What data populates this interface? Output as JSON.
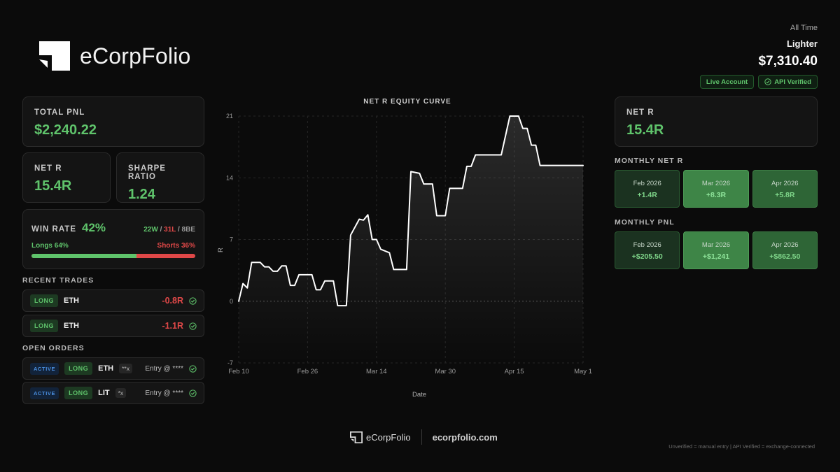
{
  "brand": {
    "name": "eCorpFolio"
  },
  "account": {
    "period": "All Time",
    "name": "Lighter",
    "balance": "$7,310.40",
    "badges": [
      "Live Account",
      "API Verified"
    ]
  },
  "stats": {
    "total_pnl_label": "TOTAL PNL",
    "total_pnl": "$2,240.22",
    "net_r_label": "NET R",
    "net_r": "15.4R",
    "sharpe_label": "SHARPE RATIO",
    "sharpe": "1.24",
    "win_rate_label": "WIN RATE",
    "win_rate": "42%",
    "wins": "22W",
    "losses": "31L",
    "breakeven": "8BE",
    "sep": "/",
    "longs_label": "Longs 64%",
    "shorts_label": "Shorts 36%",
    "longs_fraction": 0.64
  },
  "recent_trades": {
    "title": "RECENT TRADES",
    "items": [
      {
        "side": "LONG",
        "symbol": "ETH",
        "r": "-0.8R"
      },
      {
        "side": "LONG",
        "symbol": "ETH",
        "r": "-1.1R"
      }
    ]
  },
  "open_orders": {
    "title": "OPEN ORDERS",
    "items": [
      {
        "status": "ACTIVE",
        "side": "LONG",
        "symbol": "ETH",
        "qty": "**x",
        "entry": "Entry @ ****"
      },
      {
        "status": "ACTIVE",
        "side": "LONG",
        "symbol": "LIT",
        "qty": "*x",
        "entry": "Entry @ ****"
      }
    ]
  },
  "right": {
    "net_r_label": "NET R",
    "net_r": "15.4R",
    "monthly_r_title": "MONTHLY NET R",
    "monthly_r": [
      {
        "month": "Feb 2026",
        "value": "+1.4R"
      },
      {
        "month": "Mar 2026",
        "value": "+8.3R"
      },
      {
        "month": "Apr 2026",
        "value": "+5.8R"
      }
    ],
    "monthly_pnl_title": "MONTHLY PNL",
    "monthly_pnl": [
      {
        "month": "Feb 2026",
        "value": "+$205.50"
      },
      {
        "month": "Mar 2026",
        "value": "+$1,241"
      },
      {
        "month": "Apr 2026",
        "value": "+$862.50"
      }
    ]
  },
  "chart_data": {
    "type": "line",
    "title": "NET R EQUITY CURVE",
    "xlabel": "Date",
    "ylabel": "R",
    "x_ticks": [
      "Feb 10",
      "Feb 26",
      "Mar 14",
      "Mar 30",
      "Apr 15",
      "May 1"
    ],
    "x_range": [
      "2026-02-10",
      "2026-05-01"
    ],
    "y_ticks": [
      -7,
      0,
      7,
      14,
      21
    ],
    "ylim": [
      -7,
      21
    ],
    "grid": true,
    "colors": {
      "line": "#ffffff",
      "zero_line": "#555555",
      "grid": "#262626"
    },
    "series": [
      {
        "points": [
          [
            "2026-02-10",
            0.0
          ],
          [
            "2026-02-11",
            2.0
          ],
          [
            "2026-02-12",
            1.5
          ],
          [
            "2026-02-13",
            4.4
          ],
          [
            "2026-02-15",
            4.4
          ],
          [
            "2026-02-16",
            3.9
          ],
          [
            "2026-02-17",
            3.9
          ],
          [
            "2026-02-18",
            3.4
          ],
          [
            "2026-02-19",
            3.4
          ],
          [
            "2026-02-20",
            4.0
          ],
          [
            "2026-02-21",
            4.0
          ],
          [
            "2026-02-22",
            1.8
          ],
          [
            "2026-02-23",
            1.8
          ],
          [
            "2026-02-24",
            3.0
          ],
          [
            "2026-02-27",
            3.0
          ],
          [
            "2026-02-28",
            1.3
          ],
          [
            "2026-03-01",
            1.3
          ],
          [
            "2026-03-02",
            2.3
          ],
          [
            "2026-03-04",
            2.3
          ],
          [
            "2026-03-05",
            -0.5
          ],
          [
            "2026-03-07",
            -0.5
          ],
          [
            "2026-03-08",
            7.5
          ],
          [
            "2026-03-09",
            8.4
          ],
          [
            "2026-03-10",
            9.3
          ],
          [
            "2026-03-11",
            9.2
          ],
          [
            "2026-03-12",
            9.8
          ],
          [
            "2026-03-13",
            7.0
          ],
          [
            "2026-03-14",
            7.0
          ],
          [
            "2026-03-15",
            5.9
          ],
          [
            "2026-03-17",
            5.5
          ],
          [
            "2026-03-18",
            3.6
          ],
          [
            "2026-03-21",
            3.6
          ],
          [
            "2026-03-22",
            14.7
          ],
          [
            "2026-03-24",
            14.5
          ],
          [
            "2026-03-25",
            13.3
          ],
          [
            "2026-03-27",
            13.3
          ],
          [
            "2026-03-28",
            9.7
          ],
          [
            "2026-03-30",
            9.7
          ],
          [
            "2026-03-31",
            12.8
          ],
          [
            "2026-04-03",
            12.8
          ],
          [
            "2026-04-04",
            15.3
          ],
          [
            "2026-04-05",
            15.3
          ],
          [
            "2026-04-06",
            16.6
          ],
          [
            "2026-04-12",
            16.6
          ],
          [
            "2026-04-14",
            21.0
          ],
          [
            "2026-04-16",
            21.0
          ],
          [
            "2026-04-17",
            19.6
          ],
          [
            "2026-04-18",
            19.6
          ],
          [
            "2026-04-19",
            17.7
          ],
          [
            "2026-04-20",
            17.7
          ],
          [
            "2026-04-21",
            15.4
          ],
          [
            "2026-05-01",
            15.4
          ]
        ]
      }
    ]
  }
}
